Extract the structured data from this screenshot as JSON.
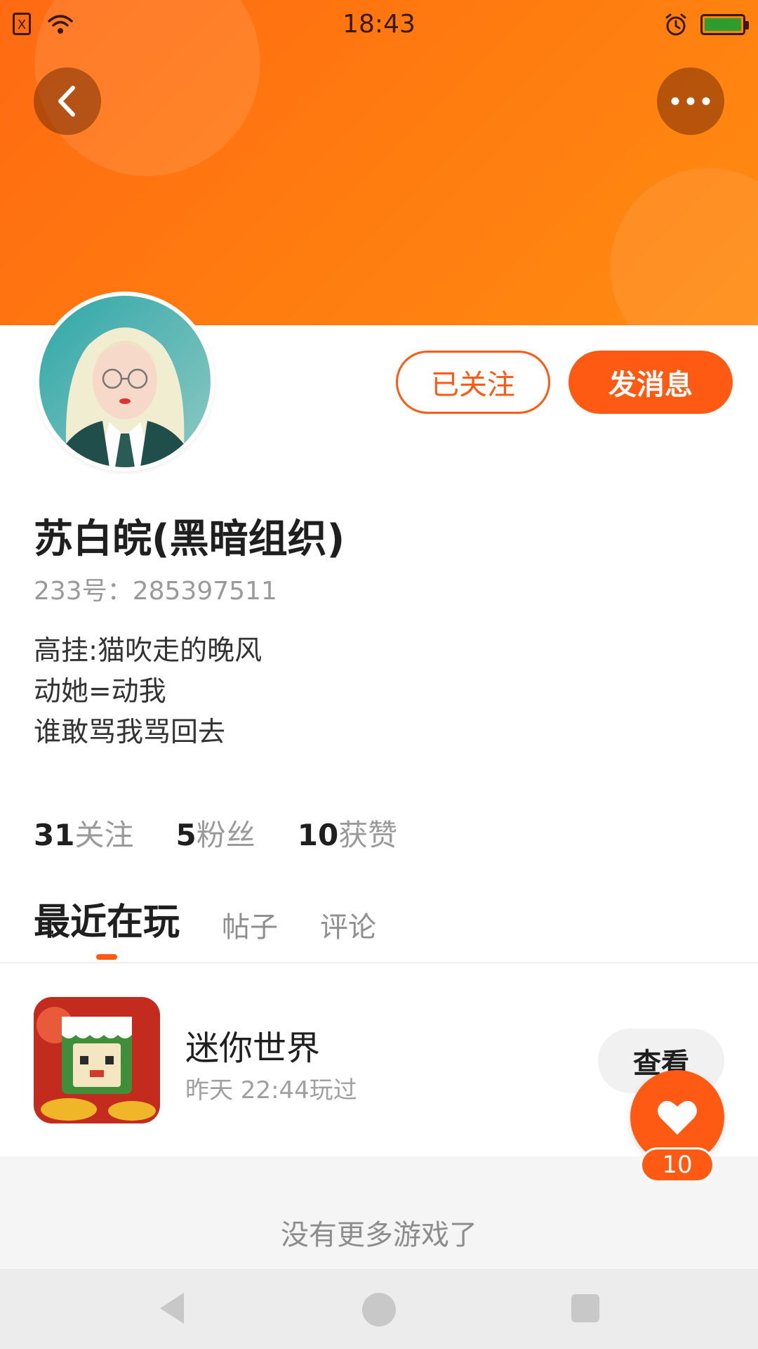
{
  "status_bar": {
    "time": "18:43",
    "sim_label": "X"
  },
  "header": {
    "back_icon": "chevron-left-icon",
    "more_icon": "more-horizontal-icon"
  },
  "profile": {
    "name": "苏白皖(黑暗组织)",
    "id_label": "233号：285397511",
    "bio": [
      "高挂:猫吹走的晚风",
      "动她=动我",
      "谁敢骂我骂回去"
    ],
    "follow_button": "已关注",
    "message_button": "发消息",
    "stats": [
      {
        "number": "31",
        "label": "关注"
      },
      {
        "number": "5",
        "label": "粉丝"
      },
      {
        "number": "10",
        "label": "获赞"
      }
    ]
  },
  "tabs": [
    "最近在玩",
    "帖子",
    "评论"
  ],
  "games": [
    {
      "title": "迷你世界",
      "meta": "昨天 22:44玩过",
      "action": "查看"
    }
  ],
  "list_end_text": "没有更多游戏了",
  "like": {
    "count": "10",
    "icon": "heart-icon"
  },
  "colors": {
    "accent": "#ff5a14",
    "banner": "#ff7d0f"
  }
}
